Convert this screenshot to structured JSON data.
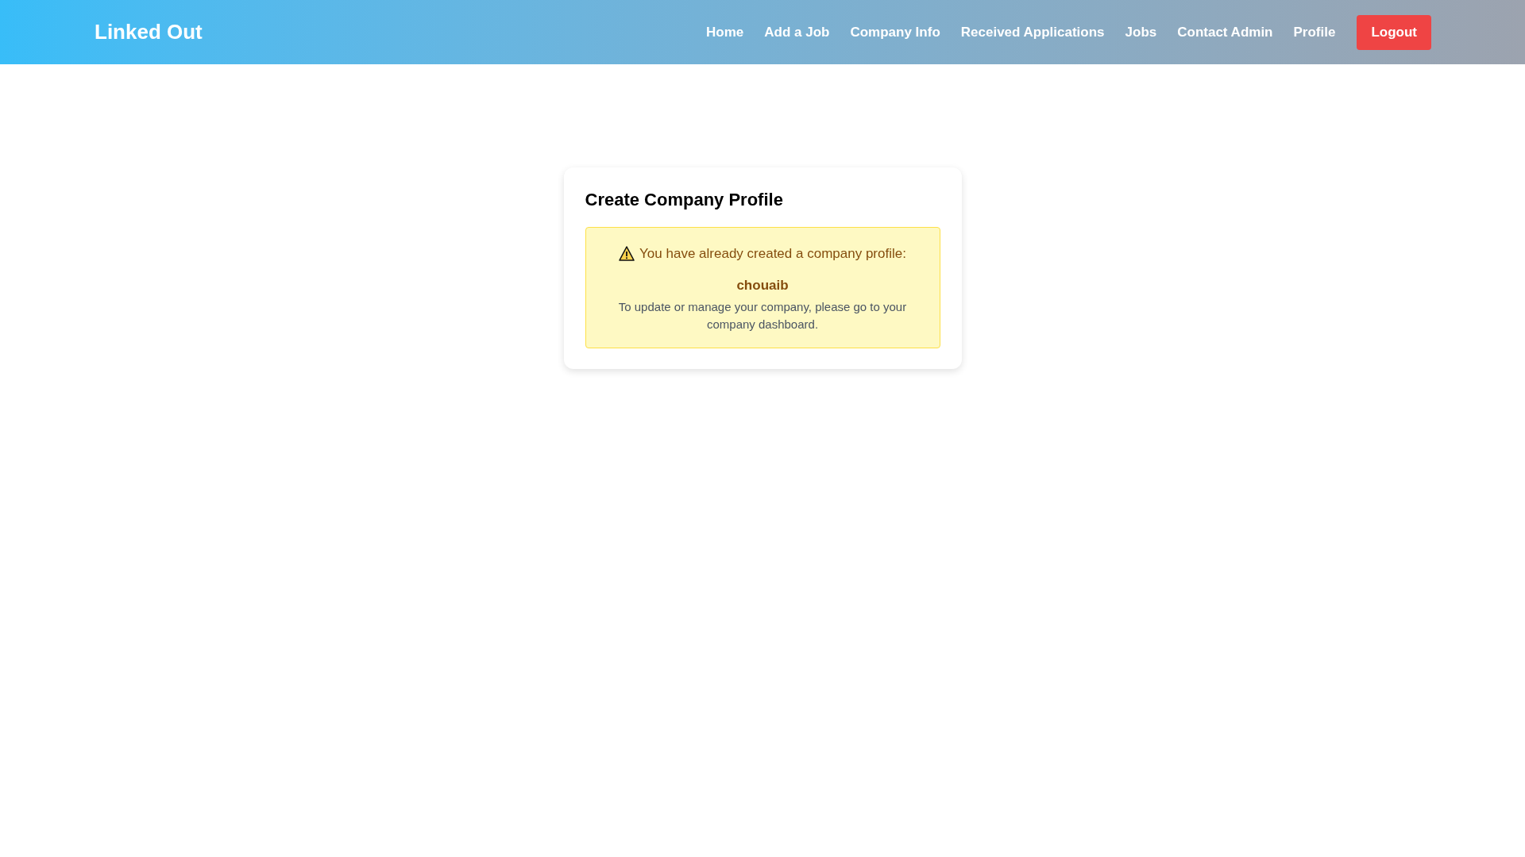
{
  "navbar": {
    "brand": "Linked Out",
    "links": [
      {
        "label": "Home"
      },
      {
        "label": "Add a Job"
      },
      {
        "label": "Company Info"
      },
      {
        "label": "Received Applications"
      },
      {
        "label": "Jobs"
      },
      {
        "label": "Contact Admin"
      },
      {
        "label": "Profile"
      }
    ],
    "logout": "Logout"
  },
  "card": {
    "title": "Create Company Profile",
    "alert": {
      "message": "You have already created a company profile:",
      "company": "chouaib",
      "hint": "To update or manage your company, please go to your company dashboard."
    }
  }
}
